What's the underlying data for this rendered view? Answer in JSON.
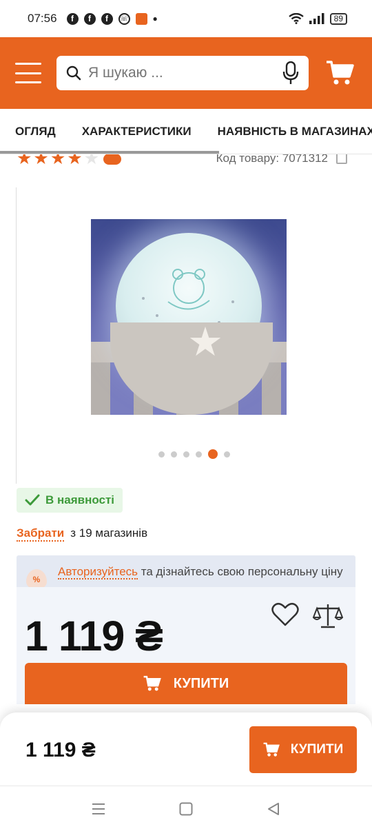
{
  "status_bar": {
    "time": "07:56",
    "app_icons": [
      "facebook-icon",
      "facebook-icon",
      "facebook-icon",
      "viber-icon",
      "app-icon"
    ],
    "battery": "89"
  },
  "header": {
    "search_placeholder": "Я шукаю ..."
  },
  "tabs": [
    {
      "label": "ОГЛЯД"
    },
    {
      "label": "ХАРАКТЕРИСТИКИ"
    },
    {
      "label": "НАЯВНІСТЬ В МАГАЗИНАХ"
    }
  ],
  "product": {
    "rating": 4,
    "rating_max": 5,
    "sku_label": "Код товару: 7071312",
    "gallery": {
      "total": 6,
      "active": 5
    },
    "stock_label": "В наявності",
    "pickup_link": "Забрати",
    "pickup_text": "з 19 магазинів",
    "auth_link": "Авторизуйтесь",
    "auth_text": " та дізнайтесь свою персональну ціну",
    "price": "1 119 ₴",
    "buy_label": "КУПИТИ"
  },
  "sticky": {
    "price": "1 119 ₴",
    "buy_label": "КУПИТИ"
  },
  "colors": {
    "accent": "#e8641f",
    "stock_green": "#3d9a3a"
  }
}
